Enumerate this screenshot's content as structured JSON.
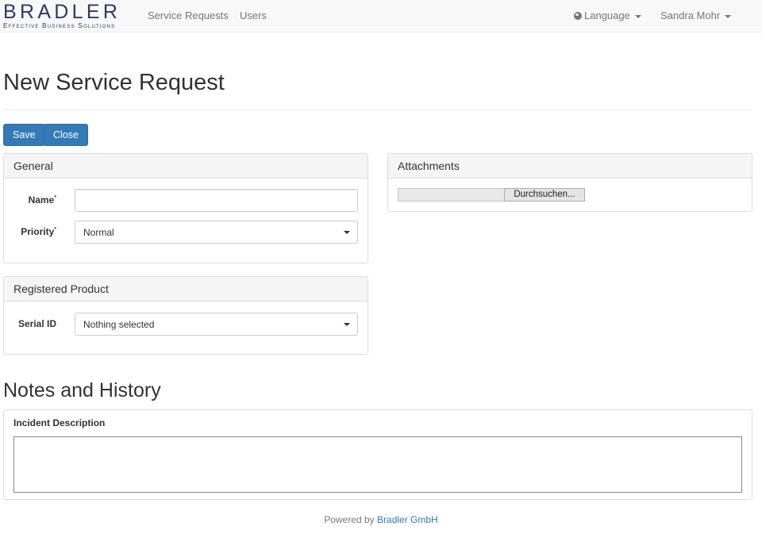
{
  "navbar": {
    "brand_name": "BRADLER",
    "brand_tagline": "Effective Business Solutions",
    "links": [
      {
        "label": "Service Requests"
      },
      {
        "label": "Users"
      }
    ],
    "language_label": "Language",
    "user_label": "Sandra Mohr",
    "icons": {
      "language": "globe-icon",
      "dropdown": "caret-down-icon"
    }
  },
  "page": {
    "title": "New Service Request"
  },
  "toolbar": {
    "save_label": "Save",
    "close_label": "Close"
  },
  "general_panel": {
    "heading": "General",
    "name_label": "Name",
    "name_value": "",
    "priority_label": "Priority",
    "priority_value": "Normal",
    "required_marker": "*"
  },
  "attachments_panel": {
    "heading": "Attachments",
    "browse_label": "Durchsuchen..."
  },
  "product_panel": {
    "heading": "Registered Product",
    "serial_label": "Serial ID",
    "serial_value": "Nothing selected"
  },
  "notes": {
    "section_title": "Notes and History",
    "description_label": "Incident Description",
    "description_value": ""
  },
  "footer": {
    "prefix": "Powered by",
    "link_label": "Bradler GmbH"
  },
  "colors": {
    "primary": "#337ab7",
    "brand": "#2d3a66",
    "navbar_bg": "#f8f8f8"
  }
}
